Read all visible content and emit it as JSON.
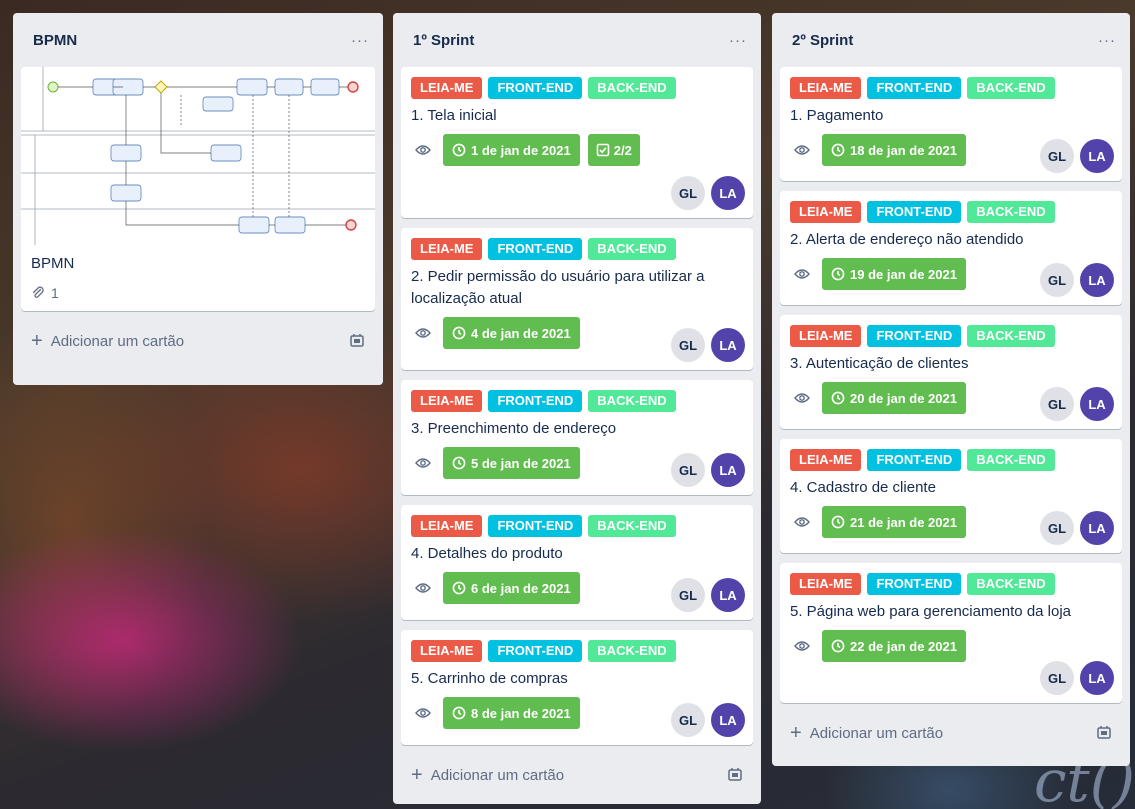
{
  "board": {
    "background_text": "ct()"
  },
  "labels": {
    "leia_me": {
      "text": "LEIA-ME",
      "color": "#eb5a46"
    },
    "front_end": {
      "text": "FRONT-END",
      "color": "#00c2e0"
    },
    "back_end": {
      "text": "BACK-END",
      "color": "#51e898"
    }
  },
  "lists": [
    {
      "title": "BPMN",
      "menu": "···",
      "cover_card": {
        "title": "BPMN",
        "attachments": "1"
      },
      "add_card": "Adicionar um cartão"
    },
    {
      "title": "1º Sprint",
      "menu": "···",
      "cards": [
        {
          "title": "1. Tela inicial",
          "due": "1 de jan de 2021",
          "checklist": "2/2",
          "members": [
            "GL",
            "LA"
          ]
        },
        {
          "title": "2. Pedir permissão do usuário para utilizar a localização atual",
          "due": "4 de jan de 2021",
          "members": [
            "GL",
            "LA"
          ]
        },
        {
          "title": "3. Preenchimento de endereço",
          "due": "5 de jan de 2021",
          "members": [
            "GL",
            "LA"
          ]
        },
        {
          "title": "4. Detalhes do produto",
          "due": "6 de jan de 2021",
          "members": [
            "GL",
            "LA"
          ]
        },
        {
          "title": "5. Carrinho de compras",
          "due": "8 de jan de 2021",
          "members": [
            "GL",
            "LA"
          ]
        }
      ],
      "add_card": "Adicionar um cartão"
    },
    {
      "title": "2º Sprint",
      "menu": "···",
      "cards": [
        {
          "title": "1. Pagamento",
          "due": "18 de jan de 2021",
          "members": [
            "GL",
            "LA"
          ]
        },
        {
          "title": "2. Alerta de endereço não atendido",
          "due": "19 de jan de 2021",
          "members": [
            "GL",
            "LA"
          ]
        },
        {
          "title": "3. Autenticação de clientes",
          "due": "20 de jan de 2021",
          "members": [
            "GL",
            "LA"
          ]
        },
        {
          "title": "4. Cadastro de cliente",
          "due": "21 de jan de 2021",
          "members": [
            "GL",
            "LA"
          ]
        },
        {
          "title": "5. Página web para gerenciamento da loja",
          "due": "22 de jan de 2021",
          "members": [
            "GL",
            "LA"
          ]
        }
      ],
      "add_card": "Adicionar um cartão"
    }
  ]
}
